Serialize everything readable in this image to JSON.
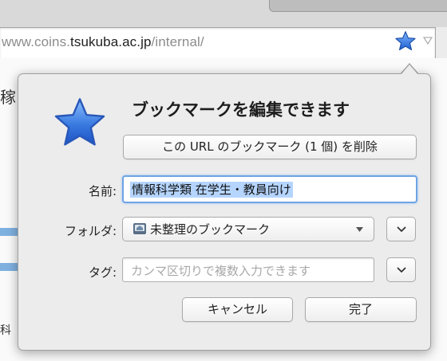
{
  "browser": {
    "url_prefix": "www.coins.",
    "url_domain": "tsukuba.ac.jp",
    "url_suffix": "/internal/"
  },
  "page_partial": {
    "glyph_top": "稼",
    "glyph_bottom": "科"
  },
  "bookmark_panel": {
    "title": "ブックマークを編集できます",
    "remove_label": "この URL のブックマーク (1 個) を削除",
    "name_label": "名前:",
    "name_value": "情報科学類 在学生・教員向け",
    "folder_label": "フォルダ:",
    "folder_value": "未整理のブックマーク",
    "tags_label": "タグ:",
    "tags_placeholder": "カンマ区切りで複数入力できます",
    "cancel_label": "キャンセル",
    "done_label": "完了"
  },
  "colors": {
    "star_fill": "#3a7be0",
    "selection": "#b5d5ff",
    "focus_ring": "#6ea3e4"
  },
  "icons": {
    "bookmark_star": "star-icon",
    "dropdown": "chevron-down-icon",
    "folder": "bookmark-folder-icon"
  }
}
